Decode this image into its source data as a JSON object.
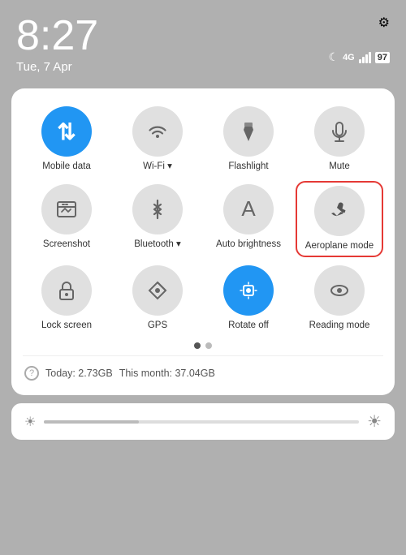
{
  "statusBar": {
    "time": "8:27",
    "date": "Tue, 7 Apr",
    "settingsIcon": "⚙",
    "moonIcon": "☾",
    "networkLabel": "4G",
    "batteryLabel": "97"
  },
  "panel": {
    "tiles": [
      {
        "id": "mobile-data",
        "label": "Mobile data",
        "icon": "⇅",
        "active": true,
        "highlighted": false
      },
      {
        "id": "wifi",
        "label": "Wi-Fi ▾",
        "icon": "⊙",
        "active": false,
        "highlighted": false
      },
      {
        "id": "flashlight",
        "label": "Flashlight",
        "icon": "⚡",
        "active": false,
        "highlighted": false
      },
      {
        "id": "mute",
        "label": "Mute",
        "icon": "🔔",
        "active": false,
        "highlighted": false
      },
      {
        "id": "screenshot",
        "label": "Screenshot",
        "icon": "✂",
        "active": false,
        "highlighted": false
      },
      {
        "id": "bluetooth",
        "label": "Bluetooth ▾",
        "icon": "✱",
        "active": false,
        "highlighted": false
      },
      {
        "id": "auto-brightness",
        "label": "Auto brightness",
        "icon": "A",
        "active": false,
        "highlighted": false
      },
      {
        "id": "aeroplane-mode",
        "label": "Aeroplane mode",
        "icon": "✈",
        "active": false,
        "highlighted": true
      },
      {
        "id": "lock-screen",
        "label": "Lock screen",
        "icon": "🔓",
        "active": false,
        "highlighted": false
      },
      {
        "id": "gps",
        "label": "GPS",
        "icon": "◎",
        "active": false,
        "highlighted": false
      },
      {
        "id": "rotate-off",
        "label": "Rotate off",
        "icon": "🔒",
        "active": true,
        "highlighted": false
      },
      {
        "id": "reading-mode",
        "label": "Reading mode",
        "icon": "👁",
        "active": false,
        "highlighted": false
      }
    ],
    "dots": [
      {
        "active": true
      },
      {
        "active": false
      }
    ],
    "dataUsage": {
      "todayLabel": "Today: 2.73GB",
      "monthLabel": "This month: 37.04GB"
    }
  },
  "brightness": {
    "fillPercent": 30
  }
}
